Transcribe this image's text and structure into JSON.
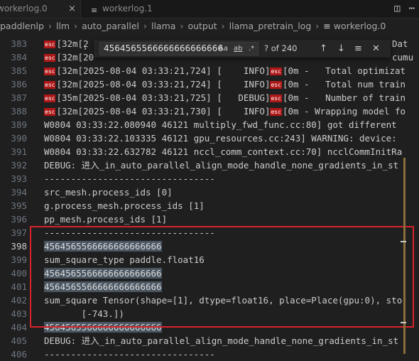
{
  "tabs": [
    {
      "label": "workerlog.0",
      "close": "×"
    },
    {
      "label": "workerlog.1"
    }
  ],
  "breadcrumb": {
    "items": [
      "paddlenlp",
      "llm",
      "auto_parallel",
      "llama",
      "output",
      "llama_pretrain_log"
    ],
    "file": "workerlog.0"
  },
  "find_widget": {
    "query": "4564565566666666666666",
    "match_case": "Aa",
    "whole_word": "ab",
    "regex": ".*",
    "count": "? of 240"
  },
  "esc_label": "esc",
  "lines": [
    {
      "num": "383",
      "text": "[32m[2",
      "esc": true,
      "tail": "Dat"
    },
    {
      "num": "384",
      "text": "[32m[20",
      "esc": true,
      "tail": "cumu"
    },
    {
      "num": "385",
      "esc": true,
      "text": "[32m[2025-08-04 03:33:21,724] [    INFO]",
      "text2": "[0m -   Total optimizat"
    },
    {
      "num": "386",
      "esc": true,
      "text": "[32m[2025-08-04 03:33:21,724] [    INFO]",
      "text2": "[0m -   Total num train"
    },
    {
      "num": "387",
      "esc": true,
      "text": "[35m[2025-08-04 03:33:21,725] [   DEBUG]",
      "text2": "[0m -   Number of train"
    },
    {
      "num": "388",
      "esc": true,
      "text": "[32m[2025-08-04 03:33:21,730] [    INFO]",
      "text2": "[0m - Wrapping model fo"
    },
    {
      "num": "389",
      "text": "W0804 03:33:22.080940 46121 multiply_fwd_func.cc:80] got different"
    },
    {
      "num": "390",
      "text": "W0804 03:33:22.103335 46121 gpu_resources.cc:243] WARNING: device:"
    },
    {
      "num": "391",
      "text": "W0804 03:33:22.632782 46121 nccl_comm_context.cc:70] ncclCommInitRa"
    },
    {
      "num": "392",
      "text": "DEBUG: 进入_in_auto_parallel_align_mode_handle_none_gradients_in_st"
    },
    {
      "num": "393",
      "text": "--------------------------------"
    },
    {
      "num": "394",
      "text": "src_mesh.process_ids [0]"
    },
    {
      "num": "395",
      "text": "g.process_mesh.process_ids [1]"
    },
    {
      "num": "396",
      "text": "pp_mesh.process_ids [1]"
    },
    {
      "num": "397",
      "text": "--------------------------------"
    },
    {
      "num": "398",
      "text": "4564565566666666666666",
      "hl": true,
      "current": true
    },
    {
      "num": "399",
      "text": "sum_square_type paddle.float16"
    },
    {
      "num": "400",
      "text": "4564565566666666666666",
      "hl": true
    },
    {
      "num": "401",
      "text": "4564565566666666666666",
      "hl": true
    },
    {
      "num": "402",
      "text": "sum_square Tensor(shape=[1], dtype=float16, place=Place(gpu:0), sto"
    },
    {
      "num": "403",
      "text": "       [-743.])"
    },
    {
      "num": "404",
      "text": "4564565566666666666666",
      "hl": true
    },
    {
      "num": "405",
      "text": "DEBUG: 进入_in_auto_parallel_align_mode_handle_none_gradients_in_st"
    },
    {
      "num": "406",
      "text": "--------------------------------"
    }
  ]
}
